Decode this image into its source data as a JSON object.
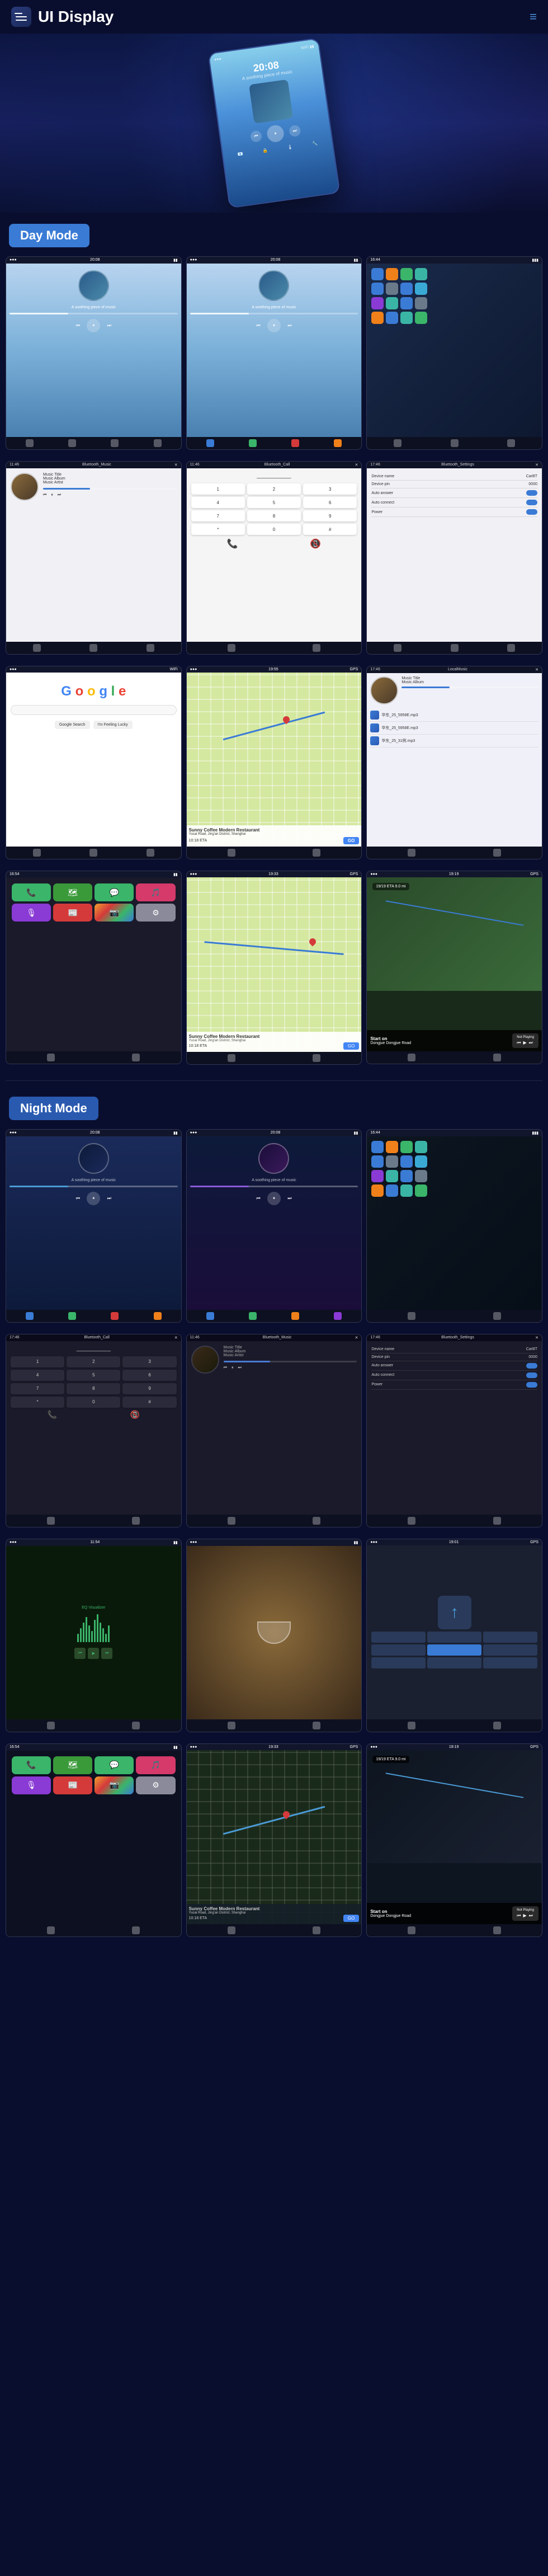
{
  "header": {
    "title": "UI Display",
    "menu_label": "menu",
    "nav_icon": "≡"
  },
  "day_mode": {
    "label": "Day Mode"
  },
  "night_mode": {
    "label": "Night Mode"
  },
  "screens": {
    "music1": {
      "time": "20:08",
      "track": "A soothing piece of music",
      "title": "Music Title",
      "album": "Music Album",
      "artist": "Music Artist"
    },
    "music2": {
      "time": "20:08",
      "track": "A soothing piece of music"
    },
    "settings": {
      "title": "Bluetooth_Settings",
      "device_name_label": "Device name",
      "device_name_value": "CarBT",
      "device_pin_label": "Device pin",
      "device_pin_value": "0000",
      "auto_answer_label": "Auto answer",
      "auto_connect_label": "Auto connect",
      "power_label": "Power"
    },
    "call": {
      "title": "Bluetooth_Call"
    },
    "local_music": {
      "title": "LocalMusic",
      "files": [
        "华东_25_5958E.mp3",
        "华东_25_5958E.mp3",
        "华东_25_31例.mp3"
      ]
    },
    "nav": {
      "eta": "19/19 ETA  9.0 mi",
      "instruction": "Start on Dongfue Dongue Road",
      "not_playing": "Not Playing"
    },
    "restaurant": {
      "name": "Sunny Coffee Modern Restaurant",
      "address": "Yucai Road, Jing'an District, Shanghai",
      "eta": "10:18 ETA",
      "go_button": "GO"
    }
  }
}
